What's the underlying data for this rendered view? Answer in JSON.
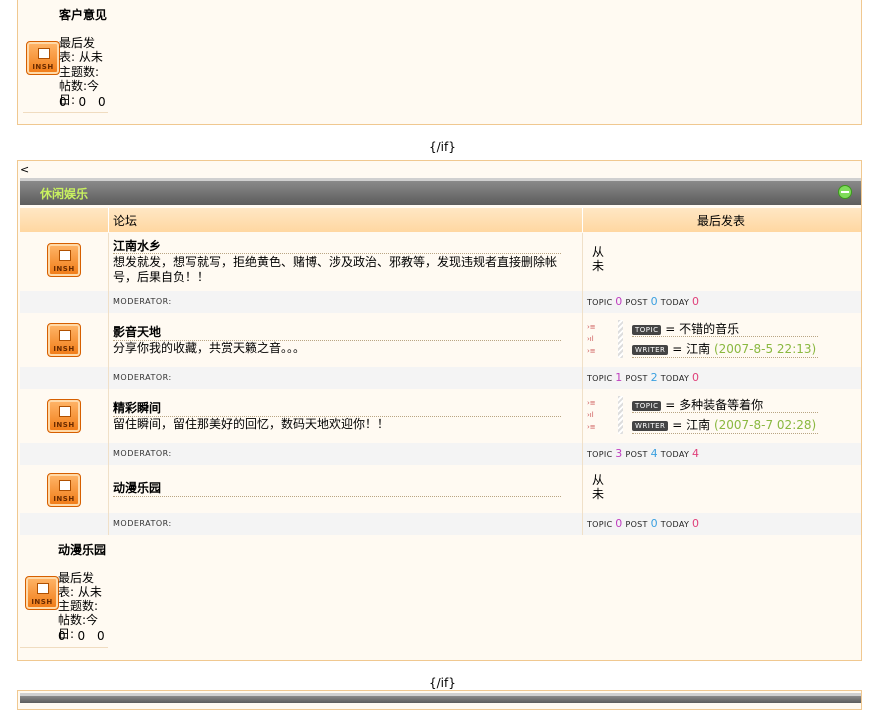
{
  "top_panel": {
    "forum_name": "客户意见",
    "last_post_label": "最后发表: 从未",
    "topic_label": "主题数:",
    "post_label": "帖数:",
    "today_label": "今日:",
    "topic_count": "0",
    "post_count": "0",
    "today_count": "0"
  },
  "if_marker_1": "{/if}",
  "lt_symbol": "<",
  "category": {
    "title": "休闲娱乐",
    "header_forum": "论坛",
    "header_last_post": "最后发表"
  },
  "icon_text": "INSH",
  "moderator_label": "MODERATOR:",
  "stat_topic_label": "TOPIC",
  "stat_post_label": "POST",
  "stat_today_label": "TODAY",
  "tag_topic": "TOPIC",
  "tag_writer": "WRITER",
  "forums": [
    {
      "name": "江南水乡",
      "desc": "想发就发，想写就写，拒绝黄色、赌博、涉及政治、邪教等，发现违规者直接删除帐号，后果自负！！",
      "last_post_text": "从未",
      "topic": "0",
      "post": "0",
      "today": "0"
    },
    {
      "name": "影音天地",
      "desc": "分享你我的收藏，共赏天籁之音。。。",
      "last_topic": "= 不错的音乐",
      "last_writer": "= 江南",
      "last_time": "(2007-8-5 22:13)",
      "topic": "1",
      "post": "2",
      "today": "0"
    },
    {
      "name": "精彩瞬间",
      "desc": "留住瞬间，留住那美好的回忆，数码天地欢迎你！！",
      "last_topic": "= 多种装备等着你",
      "last_writer": "= 江南",
      "last_time": "(2007-8-7 02:28)",
      "topic": "3",
      "post": "4",
      "today": "4"
    },
    {
      "name": "动漫乐园",
      "desc": "",
      "last_post_text": "从未",
      "topic": "0",
      "post": "0",
      "today": "0"
    }
  ],
  "bottom_panel": {
    "forum_name": "动漫乐园",
    "last_post_label": "最后发表: 从未",
    "topic_label": "主题数:",
    "post_label": "帖数:",
    "today_label": "今日:",
    "topic_count": "0",
    "post_count": "0",
    "today_count": "0"
  },
  "if_marker_2": "{/if}"
}
